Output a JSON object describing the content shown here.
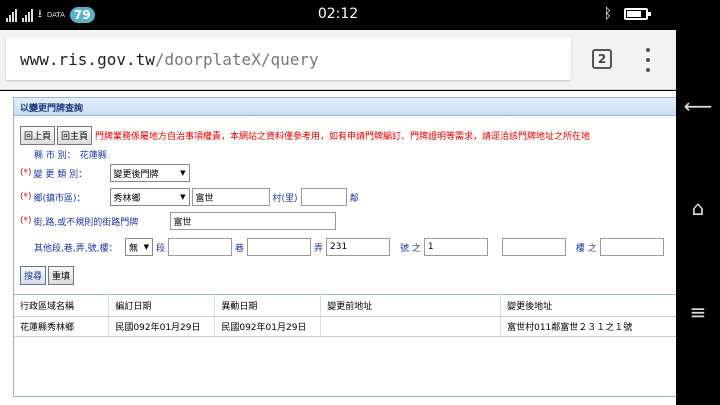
{
  "statusbar": {
    "data_label": "DATA",
    "battery_badge": "79",
    "time": "02:12",
    "bluetooth_icon": "bluetooth-icon"
  },
  "browser": {
    "url_host": "www.ris.gov.tw",
    "url_path": "/doorplateX/query",
    "tab_count": "2"
  },
  "form": {
    "title": "以變更門牌查詢",
    "back_label": "回上頁",
    "home_label": "回主頁",
    "notice": "門牌業務係屬地方自治事項權責，本網站之資料僅參考用，如有申請門牌編訂、門牌證明等需求，請逕洽該門牌地址之所在地",
    "county_label": "縣 市 別：",
    "county_value": "花蓮縣",
    "req_mark": "(*)",
    "change_type_label": "變 更 類 別：",
    "change_type_value": "變更後門牌",
    "township_label": "鄉(鎮市區)：",
    "township_value": "秀林鄉",
    "village_value": "富世",
    "village_label": "村(里)",
    "neighbor_value": "",
    "neighbor_label": "鄰",
    "street_label": "街,路,或不規則的街路門牌",
    "street_value": "富世",
    "other_label": "其他段,巷,弄,號,樓：",
    "other_select": "無",
    "section_value": "",
    "section_label": "段",
    "lane_value": "",
    "lane_label": "巷",
    "alley_value": "231",
    "alley_label": "弄",
    "number_label": "號 之",
    "number_value": "1",
    "floor_pre_value": "",
    "floor_label": "樓 之",
    "floor_value": "",
    "search_label": "搜尋",
    "reset_label": "重填"
  },
  "table": {
    "headers": [
      "行政區域名稱",
      "編訂日期",
      "異動日期",
      "變更前地址",
      "變更後地址"
    ],
    "rows": [
      [
        "花蓮縣秀林鄉",
        "民國092年01月29日",
        "民國092年01月29日",
        "",
        "富世村011鄰富世２３１之１號"
      ]
    ]
  }
}
